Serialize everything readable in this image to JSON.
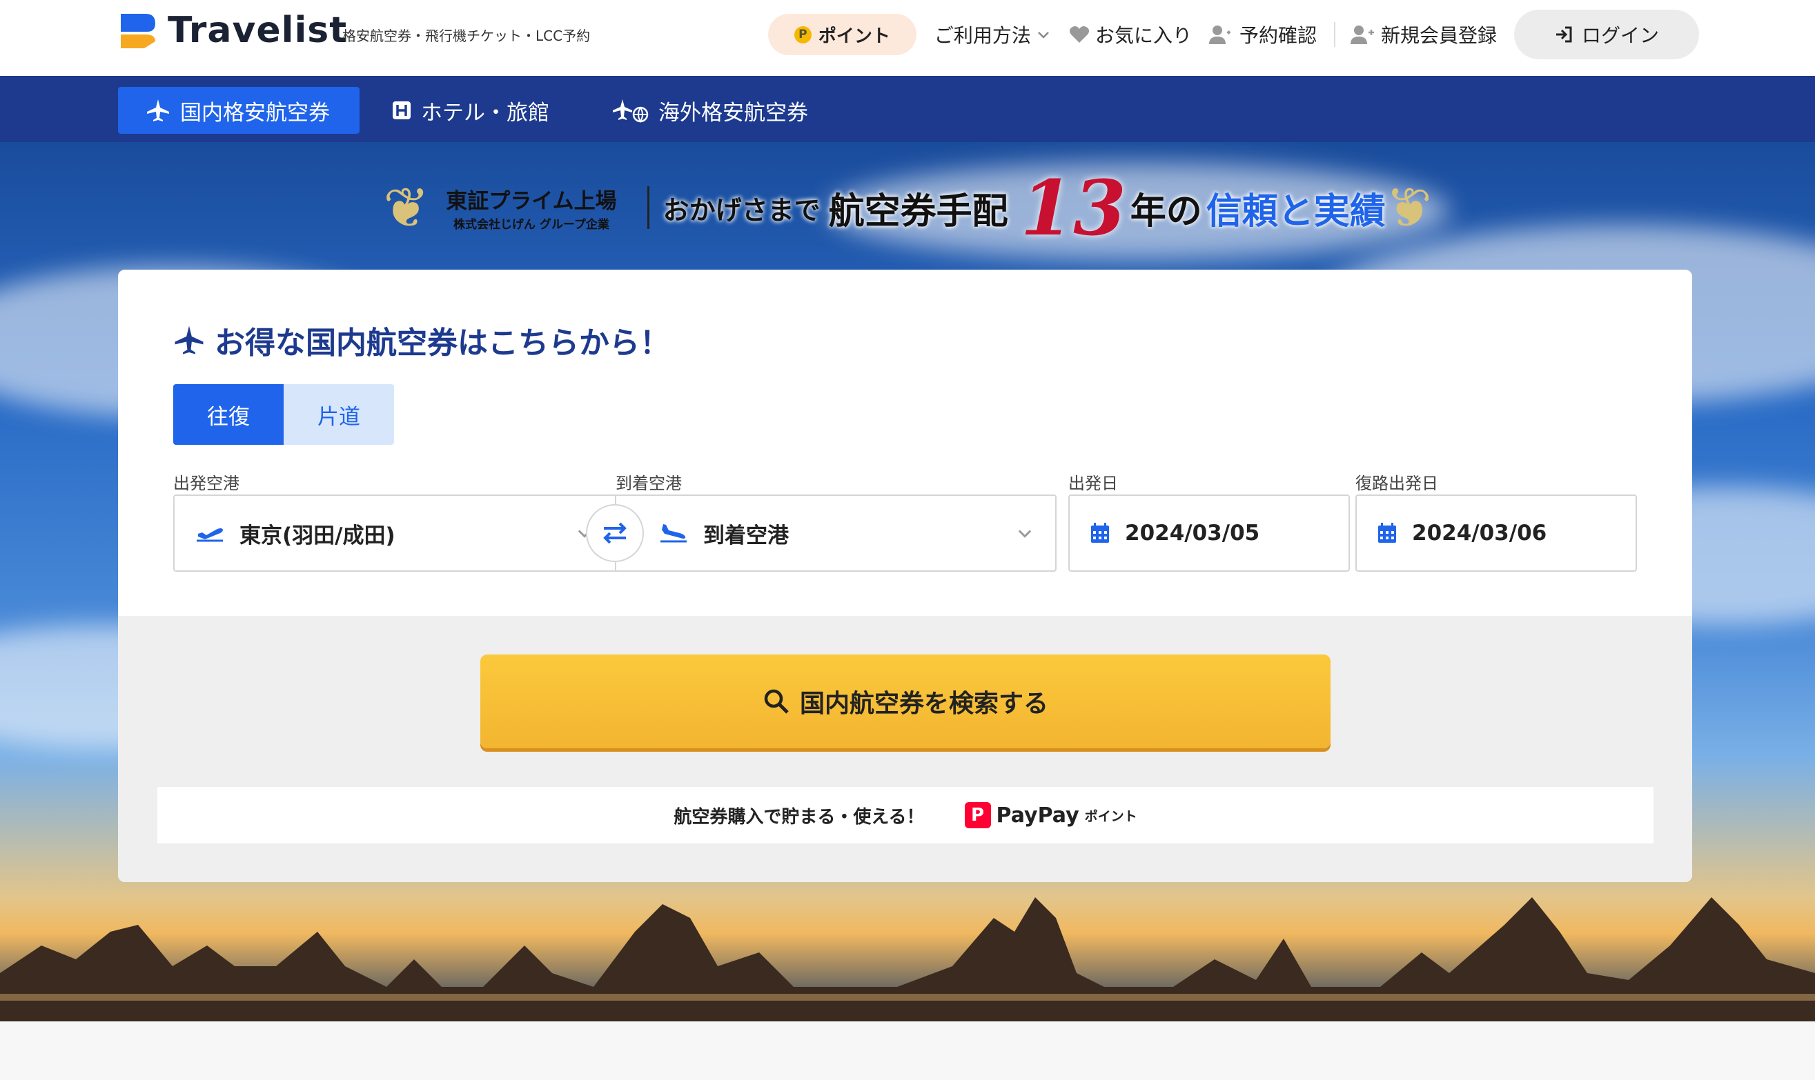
{
  "header": {
    "brand": "Travelist",
    "tagline": "格安航空券・飛行機チケット・LCC予約",
    "point_label": "ポイント",
    "point_coin": "P",
    "usage_label": "ご利用方法",
    "favorites_label": "お気に入り",
    "booking_label": "予約確認",
    "register_label": "新規会員登録",
    "login_label": "ログイン"
  },
  "nav": {
    "tabs": [
      {
        "label": "国内格安航空券",
        "active": true
      },
      {
        "label": "ホテル・旅館",
        "active": false
      },
      {
        "label": "海外格安航空券",
        "active": false
      }
    ]
  },
  "banner": {
    "listing": "東証プライム上場",
    "company": "株式会社じげん グループ企業",
    "thanks": "おかげさまで",
    "arrangement": "航空券手配",
    "years": "13",
    "year_suffix": "年の",
    "trust": "信頼と実績"
  },
  "search": {
    "title": "お得な国内航空券はこちらから！",
    "trip_round": "往復",
    "trip_oneway": "片道",
    "departure_label": "出発空港",
    "departure_value": "東京(羽田/成田)",
    "arrival_label": "到着空港",
    "arrival_value": "到着空港",
    "depart_date_label": "出発日",
    "depart_date_value": "2024/03/05",
    "return_date_label": "復路出発日",
    "return_date_value": "2024/03/06",
    "search_button": "国内航空券を検索する",
    "paypay_text": "航空券購入で貯まる・使える！",
    "paypay_brand": "PayPay",
    "paypay_sub": "ポイント"
  },
  "colors": {
    "primary": "#1f64ea",
    "navy": "#1d3a8f",
    "search_button": "#f6bb34",
    "accent_red": "#c81030",
    "paypay": "#ff0033"
  },
  "icons": [
    "logo-icon",
    "chevron-down-icon",
    "heart-icon",
    "user-check-icon",
    "user-plus-icon",
    "login-icon",
    "plane-icon",
    "hotel-icon",
    "plane-globe-icon",
    "plane-takeoff-icon",
    "plane-landing-icon",
    "swap-icon",
    "calendar-icon",
    "search-icon"
  ]
}
